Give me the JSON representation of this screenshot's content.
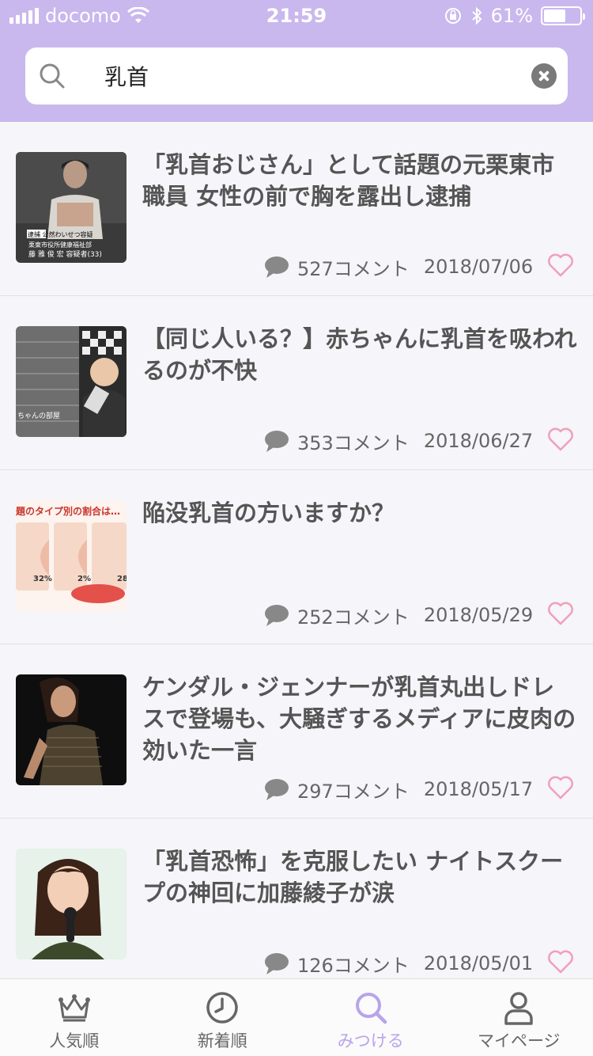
{
  "status_bar": {
    "carrier": "docomo",
    "time": "21:59",
    "battery": "61%",
    "battery_level": 0.61
  },
  "search": {
    "value": "乳首",
    "placeholder": ""
  },
  "articles": [
    {
      "title": "「乳首おじさん」として話題の元栗東市職員 女性の前で胸を露出し逮捕",
      "comments": "527コメント",
      "date": "2018/07/06",
      "thumb_caption_1": "逮捕 公然わいせつ容疑",
      "thumb_caption_2": "栗東市役所健康福祉部",
      "thumb_caption_3": "藤 雅 俊 宏 容疑者(33)"
    },
    {
      "title": "【同じ人いる？】赤ちゃんに乳首を吸われるのが不快",
      "comments": "353コメント",
      "date": "2018/06/27",
      "thumb_caption_1": "ちゃんの部屋"
    },
    {
      "title": "陥没乳首の方いますか？",
      "comments": "252コメント",
      "date": "2018/05/29",
      "thumb_caption_1": "題のタイプ別の割合は…",
      "thumb_caption_2": "32%",
      "thumb_caption_3": "2%",
      "thumb_caption_4": "28"
    },
    {
      "title": "ケンダル・ジェンナーが乳首丸出しドレスで登場も、大騒ぎするメディアに皮肉の効いた一言",
      "comments": "297コメント",
      "date": "2018/05/17"
    },
    {
      "title": "「乳首恐怖」を克服したい ナイトスクープの神回に加藤綾子が涙",
      "comments": "126コメント",
      "date": "2018/05/01"
    }
  ],
  "tabs": [
    {
      "label": "人気順",
      "icon": "crown-icon"
    },
    {
      "label": "新着順",
      "icon": "clock-icon"
    },
    {
      "label": "みつける",
      "icon": "search-icon",
      "active": true
    },
    {
      "label": "マイページ",
      "icon": "user-icon"
    }
  ],
  "colors": {
    "header": "#c9b8ee",
    "accent": "#b8a4ea",
    "heart": "#f0a0b8"
  }
}
